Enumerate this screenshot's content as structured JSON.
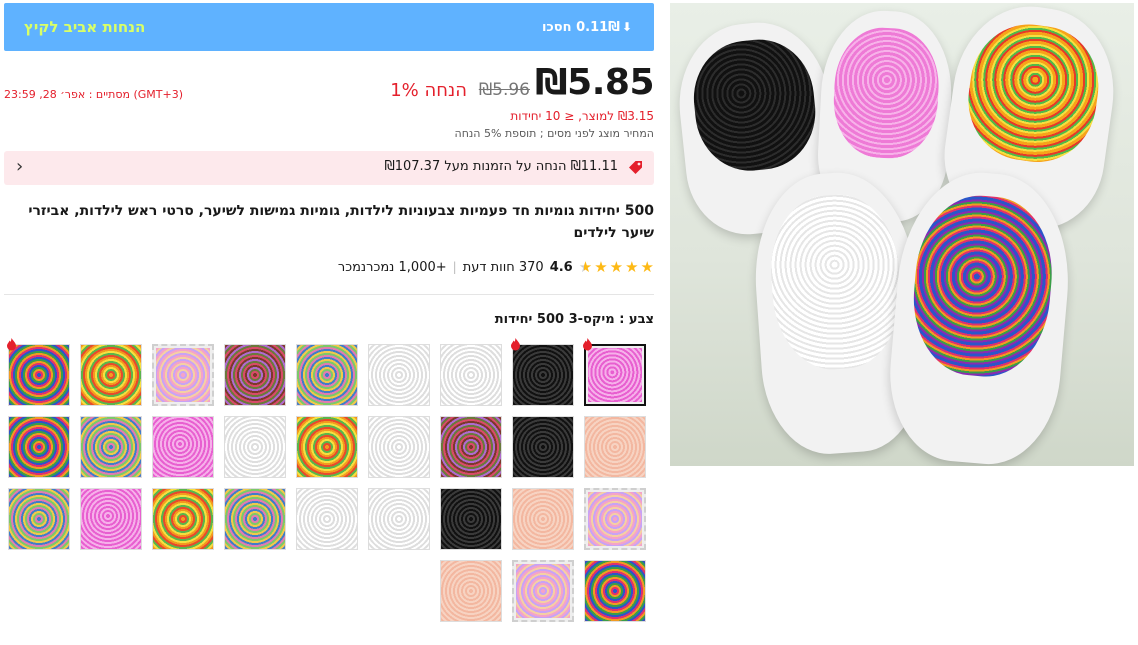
{
  "banner": {
    "title": "הנחות אביב לקיץ",
    "save": "0.11₪ חסכו"
  },
  "price": {
    "current": "₪5.85",
    "original": "₪5.96",
    "discount": "1% הנחה",
    "ends": "מסתיים : אפר׳ 28, 23:59 (GMT+3)",
    "per_unit": "₪3.15 למוצר, ≤ 10 יחידות",
    "tax_note": "המחיר מוצג לפני מסים ; תוספת 5% הנחה"
  },
  "coupon": {
    "text": "₪11.11 הנחה על הזמנות מעל ₪107.37"
  },
  "product": {
    "title": "500 יחידות גומיות חד פעמיות צבעוניות לילדות, גומיות גמישות לשיער, סרטי ראש לילדות, אביזרי שיער לילדים"
  },
  "rating": {
    "value": "4.6",
    "reviews": "370 חוות דעת",
    "sold": "+1,000 נמכרנמכר"
  },
  "variant": {
    "label": "צבע : מיקס-3 500 יחידות"
  },
  "colors": {
    "accent_red": "#e4202c",
    "banner_blue": "#5fb2ff",
    "banner_title": "#d9ff66",
    "coupon_bg": "#fde9ec",
    "star": "#fdb915"
  },
  "swatches": [
    {
      "row": 0,
      "col": 0,
      "theme": "pink",
      "selected": true,
      "hot": true
    },
    {
      "row": 0,
      "col": 1,
      "theme": "black",
      "hot": true
    },
    {
      "row": 0,
      "col": 2,
      "theme": "white"
    },
    {
      "row": 0,
      "col": 3,
      "theme": "white"
    },
    {
      "row": 0,
      "col": 4,
      "theme": "mixblue"
    },
    {
      "row": 0,
      "col": 5,
      "theme": "mixdark"
    },
    {
      "row": 0,
      "col": 6,
      "theme": "pastel",
      "dashed": true
    },
    {
      "row": 0,
      "col": 7,
      "theme": "orange"
    },
    {
      "row": 0,
      "col": 8,
      "theme": "mix",
      "hot": true
    },
    {
      "row": 1,
      "col": 0,
      "theme": "peach"
    },
    {
      "row": 1,
      "col": 1,
      "theme": "black"
    },
    {
      "row": 1,
      "col": 2,
      "theme": "mixdark"
    },
    {
      "row": 1,
      "col": 3,
      "theme": "white"
    },
    {
      "row": 1,
      "col": 4,
      "theme": "orange"
    },
    {
      "row": 1,
      "col": 5,
      "theme": "white"
    },
    {
      "row": 1,
      "col": 6,
      "theme": "pink"
    },
    {
      "row": 1,
      "col": 7,
      "theme": "mixblue"
    },
    {
      "row": 1,
      "col": 8,
      "theme": "mix"
    },
    {
      "row": 2,
      "col": 0,
      "theme": "pastel",
      "dashed": true
    },
    {
      "row": 2,
      "col": 1,
      "theme": "peach"
    },
    {
      "row": 2,
      "col": 2,
      "theme": "black"
    },
    {
      "row": 2,
      "col": 3,
      "theme": "white"
    },
    {
      "row": 2,
      "col": 4,
      "theme": "white"
    },
    {
      "row": 2,
      "col": 5,
      "theme": "mixblue"
    },
    {
      "row": 2,
      "col": 6,
      "theme": "orange"
    },
    {
      "row": 2,
      "col": 7,
      "theme": "pink"
    },
    {
      "row": 2,
      "col": 8,
      "theme": "mixblue"
    },
    {
      "row": 3,
      "col": 0,
      "theme": "mix"
    },
    {
      "row": 3,
      "col": 1,
      "theme": "pastel",
      "dashed": true
    },
    {
      "row": 3,
      "col": 2,
      "theme": "peach"
    }
  ]
}
